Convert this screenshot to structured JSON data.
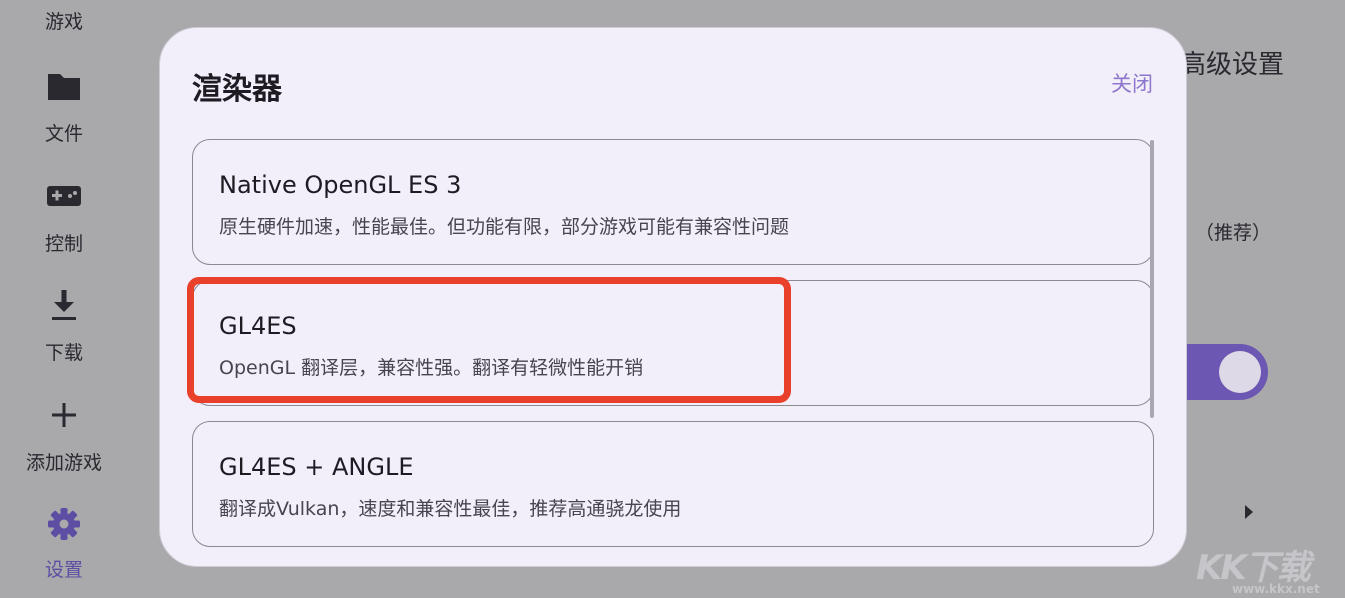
{
  "nav": {
    "items": [
      {
        "label": "游戏",
        "icon": "games-icon"
      },
      {
        "label": "文件",
        "icon": "folder-icon"
      },
      {
        "label": "控制",
        "icon": "gamepad-icon"
      },
      {
        "label": "下载",
        "icon": "download-icon"
      },
      {
        "label": "添加游戏",
        "icon": "plus-icon"
      },
      {
        "label": "设置",
        "icon": "gear-icon",
        "active": true
      }
    ]
  },
  "background": {
    "title_fragment": "高级设置",
    "recommend_fragment": "（推荐）",
    "toggle_on": true
  },
  "dialog": {
    "title": "渲染器",
    "close_label": "关闭",
    "options": [
      {
        "name": "Native OpenGL ES 3",
        "desc": "原生硬件加速，性能最佳。但功能有限，部分游戏可能有兼容性问题"
      },
      {
        "name": "GL4ES",
        "desc": "OpenGL 翻译层，兼容性强。翻译有轻微性能开销"
      },
      {
        "name": "GL4ES + ANGLE",
        "desc": "翻译成Vulkan，速度和兼容性最佳，推荐高通骁龙使用"
      }
    ]
  },
  "watermark": {
    "brand": "KK下载",
    "url": "www.kkx.net"
  },
  "colors": {
    "accent": "#8e77cc",
    "active_nav": "#5e4ea3",
    "toggle": "#6c58b3",
    "highlight": "#e8402a",
    "dialog_bg": "#f2eefa",
    "scrim": "#a9a8ab"
  }
}
